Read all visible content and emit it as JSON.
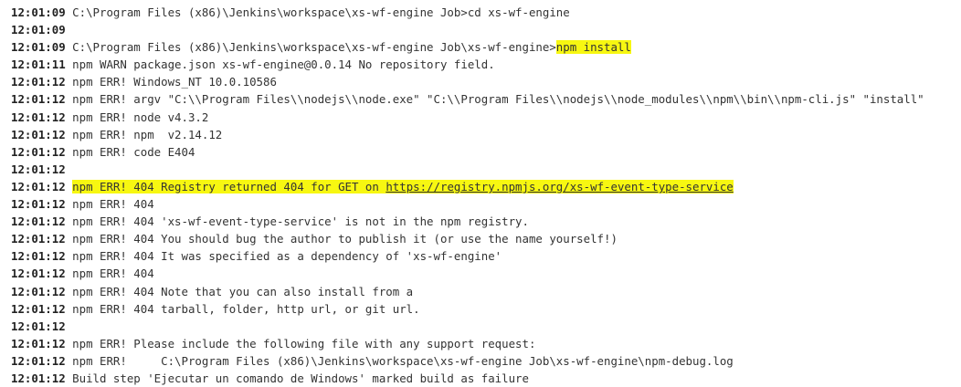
{
  "colors": {
    "background": "#ffffff",
    "text": "#333333",
    "highlight": "#f7f711"
  },
  "console": {
    "lines": [
      {
        "ts": "12:01:09",
        "text": " C:\\Program Files (x86)\\Jenkins\\workspace\\xs-wf-engine Job>cd xs-wf-engine"
      },
      {
        "ts": "12:01:09",
        "text": ""
      },
      {
        "ts": "12:01:09",
        "text": " C:\\Program Files (x86)\\Jenkins\\workspace\\xs-wf-engine Job\\xs-wf-engine>",
        "hl": "npm install"
      },
      {
        "ts": "12:01:11",
        "text": " npm WARN package.json xs-wf-engine@0.0.14 No repository field."
      },
      {
        "ts": "12:01:12",
        "text": " npm ERR! Windows_NT 10.0.10586"
      },
      {
        "ts": "12:01:12",
        "text": " npm ERR! argv \"C:\\\\Program Files\\\\nodejs\\\\node.exe\" \"C:\\\\Program Files\\\\nodejs\\\\node_modules\\\\npm\\\\bin\\\\npm-cli.js\" \"install\""
      },
      {
        "ts": "12:01:12",
        "text": " npm ERR! node v4.3.2"
      },
      {
        "ts": "12:01:12",
        "text": " npm ERR! npm  v2.14.12"
      },
      {
        "ts": "12:01:12",
        "text": " npm ERR! code E404"
      },
      {
        "ts": "12:01:12",
        "text": ""
      },
      {
        "ts": "12:01:12",
        "text": " ",
        "hl": "npm ERR! 404 Registry returned 404 for GET on ",
        "link": "https://registry.npmjs.org/xs-wf-event-type-service"
      },
      {
        "ts": "12:01:12",
        "text": " npm ERR! 404"
      },
      {
        "ts": "12:01:12",
        "text": " npm ERR! 404 'xs-wf-event-type-service' is not in the npm registry."
      },
      {
        "ts": "12:01:12",
        "text": " npm ERR! 404 You should bug the author to publish it (or use the name yourself!)"
      },
      {
        "ts": "12:01:12",
        "text": " npm ERR! 404 It was specified as a dependency of 'xs-wf-engine'"
      },
      {
        "ts": "12:01:12",
        "text": " npm ERR! 404"
      },
      {
        "ts": "12:01:12",
        "text": " npm ERR! 404 Note that you can also install from a"
      },
      {
        "ts": "12:01:12",
        "text": " npm ERR! 404 tarball, folder, http url, or git url."
      },
      {
        "ts": "12:01:12",
        "text": ""
      },
      {
        "ts": "12:01:12",
        "text": " npm ERR! Please include the following file with any support request:"
      },
      {
        "ts": "12:01:12",
        "text": " npm ERR!     C:\\Program Files (x86)\\Jenkins\\workspace\\xs-wf-engine Job\\xs-wf-engine\\npm-debug.log"
      },
      {
        "ts": "12:01:12",
        "text": " Build step 'Ejecutar un comando de Windows' marked build as failure"
      }
    ]
  }
}
